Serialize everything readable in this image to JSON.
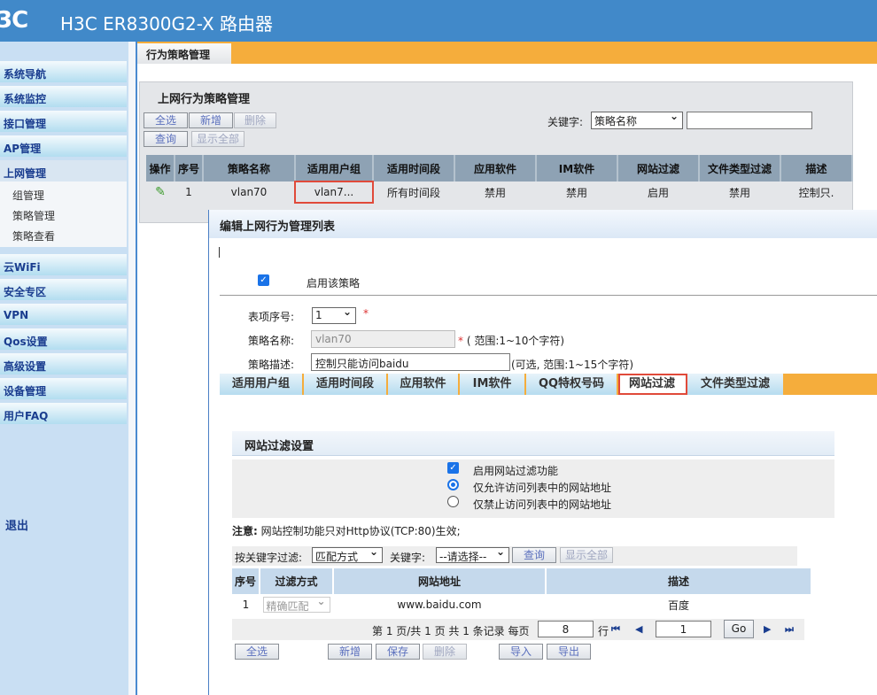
{
  "header": {
    "logo": "3C",
    "title": "H3C ER8300G2-X 路由器"
  },
  "sidebar": {
    "items": [
      "系统导航",
      "系统监控",
      "接口管理",
      "AP管理",
      "上网管理",
      "云WiFi",
      "安全专区",
      "VPN",
      "Qos设置",
      "高级设置",
      "设备管理",
      "用户FAQ"
    ],
    "subitems": [
      "组管理",
      "策略管理",
      "策略查看"
    ],
    "logout": "退出"
  },
  "tab": {
    "label": "行为策略管理"
  },
  "panel": {
    "title": "上网行为策略管理",
    "buttons": {
      "select_all": "全选",
      "add": "新增",
      "delete": "删除",
      "query": "查询",
      "show_all": "显示全部"
    },
    "keyword_label": "关键字:",
    "keyword_select": "策略名称",
    "keyword_value": "",
    "columns": [
      "操作",
      "序号",
      "策略名称",
      "适用用户组",
      "适用时间段",
      "应用软件",
      "IM软件",
      "网站过滤",
      "文件类型过滤",
      "描述"
    ],
    "rows": [
      {
        "no": "1",
        "name": "vlan70",
        "group": "vlan7...",
        "time": "所有时间段",
        "app": "禁用",
        "im": "禁用",
        "web": "启用",
        "file": "禁用",
        "desc": "控制只."
      }
    ]
  },
  "modal": {
    "title": "编辑上网行为管理列表",
    "enable_label": "启用该策略",
    "index_label": "表项序号:",
    "index_value": "1",
    "required": "*",
    "name_label": "策略名称:",
    "name_value": "vlan70",
    "name_hint": "( 范围:1~10个字符)",
    "desc_label": "策略描述:",
    "desc_value": "控制只能访问baidu",
    "desc_hint": "(可选, 范围:1~15个字符)",
    "tabs": [
      "适用用户组",
      "适用时间段",
      "应用软件",
      "IM软件",
      "QQ特权号码",
      "网站过滤",
      "文件类型过滤"
    ],
    "active_tab": "网站过滤",
    "webfilter": {
      "title": "网站过滤设置",
      "enable": "启用网站过滤功能",
      "allow_only": "仅允许访问列表中的网站地址",
      "deny_only": "仅禁止访问列表中的网站地址",
      "note_label": "注意:",
      "note": "网站控制功能只对Http协议(TCP:80)生效;",
      "filter_label": "按关键字过滤:",
      "filter_select": "匹配方式",
      "keyword_label": "关键字:",
      "keyword_select": "--请选择--",
      "query": "查询",
      "show_all": "显示全部",
      "columns": [
        "序号",
        "过滤方式",
        "网站地址",
        "描述"
      ],
      "rows": [
        {
          "no": "1",
          "mode": "精确匹配",
          "url": "www.baidu.com",
          "desc": "百度"
        }
      ],
      "pager": {
        "text": "第 1 页/共 1 页 共 1 条记录 每页",
        "per_page": "8",
        "rows_label": "行",
        "page": "1",
        "go": "Go"
      },
      "buttons": {
        "select_all": "全选",
        "add": "新增",
        "save": "保存",
        "delete": "删除",
        "import": "导入",
        "export": "导出"
      }
    }
  },
  "colors": {
    "header": "#4189c9",
    "accent": "#f5ad3c",
    "highlight": "#e04a3a"
  }
}
